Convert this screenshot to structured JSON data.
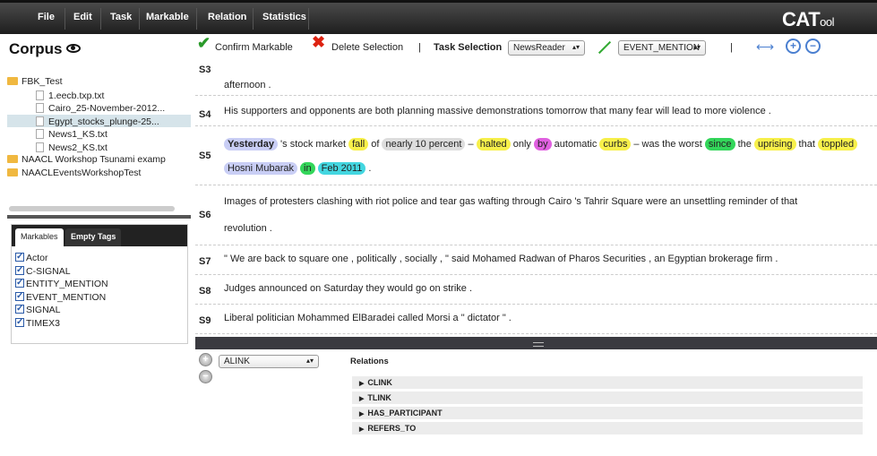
{
  "menubar": {
    "items": [
      "File",
      "Edit",
      "Task",
      "Markable",
      "Relation",
      "Statistics"
    ],
    "logo_main": "CAT",
    "logo_suffix": "ool"
  },
  "corpus": {
    "title": "Corpus"
  },
  "toolbar": {
    "confirm_label": "Confirm Markable",
    "delete_label": "Delete Selection",
    "pipe1": "|",
    "task_label": "Task Selection",
    "task_value": "NewsReader",
    "markable_type_value": "EVENT_MENTION",
    "pipe2": "|"
  },
  "tree": [
    {
      "type": "folder",
      "label": "FBK_Test"
    },
    {
      "type": "file",
      "label": "1.eecb.txp.txt"
    },
    {
      "type": "file",
      "label": "Cairo_25-November-2012..."
    },
    {
      "type": "file",
      "label": "Egypt_stocks_plunge-25...",
      "selected": true
    },
    {
      "type": "file",
      "label": "News1_KS.txt"
    },
    {
      "type": "file",
      "label": "News2_KS.txt"
    },
    {
      "type": "folder",
      "label": "NAACL Workshop Tsunami examp"
    },
    {
      "type": "folder",
      "label": "NAACLEventsWorkshopTest"
    }
  ],
  "tabs": {
    "markables": "Markables",
    "empty_tags": "Empty Tags"
  },
  "markables": [
    "Actor",
    "C-SIGNAL",
    "ENTITY_MENTION",
    "EVENT_MENTION",
    "SIGNAL",
    "TIMEX3"
  ],
  "sentences": {
    "s3": {
      "id": "S3",
      "text": "afternoon ."
    },
    "s4": {
      "id": "S4",
      "text": "His supporters and opponents are both planning massive demonstrations tomorrow that many fear will lead to more violence ."
    },
    "s5": {
      "id": "S5",
      "tokens": [
        {
          "text": "Yesterday",
          "cls": "t-blue bold"
        },
        {
          "text": " 's stock market ",
          "cls": ""
        },
        {
          "text": "fall",
          "cls": "t-yellow"
        },
        {
          "text": " of ",
          "cls": ""
        },
        {
          "text": "nearly 10 percent",
          "cls": "t-grey"
        },
        {
          "text": " – ",
          "cls": ""
        },
        {
          "text": "halted",
          "cls": "t-yellow"
        },
        {
          "text": " only ",
          "cls": ""
        },
        {
          "text": "by",
          "cls": "t-magenta"
        },
        {
          "text": " automatic ",
          "cls": ""
        },
        {
          "text": "curbs",
          "cls": "t-yellow"
        },
        {
          "text": " – was the worst ",
          "cls": ""
        },
        {
          "text": "since",
          "cls": "t-green"
        },
        {
          "text": " the ",
          "cls": ""
        },
        {
          "text": "uprising",
          "cls": "t-yellow"
        },
        {
          "text": " that ",
          "cls": ""
        },
        {
          "text": "toppled",
          "cls": "t-yellow"
        }
      ],
      "line2": [
        {
          "text": "Hosni Mubarak",
          "cls": "t-blue"
        },
        {
          "text": " ",
          "cls": ""
        },
        {
          "text": "in",
          "cls": "t-green"
        },
        {
          "text": " ",
          "cls": ""
        },
        {
          "text": "Feb 2011",
          "cls": "t-cyan"
        },
        {
          "text": " .",
          "cls": ""
        }
      ]
    },
    "s6": {
      "id": "S6",
      "line1": "Images of protesters clashing with riot police and tear gas wafting through Cairo 's Tahrir Square were an unsettling reminder of that",
      "line2": "revolution ."
    },
    "s7": {
      "id": "S7",
      "text": "\" We are back to square one , politically , socially , \" said Mohamed Radwan of Pharos Securities , an Egyptian brokerage firm ."
    },
    "s8": {
      "id": "S8",
      "text": "Judges announced on Saturday they would go on strike ."
    },
    "s9": {
      "id": "S9",
      "text": "Liberal politician Mohammed ElBaradei called Morsi a \" dictator \" ."
    }
  },
  "relations": {
    "select_value": "ALINK",
    "title": "Relations",
    "items": [
      "CLINK",
      "TLINK",
      "HAS_PARTICIPANT",
      "REFERS_TO"
    ]
  }
}
